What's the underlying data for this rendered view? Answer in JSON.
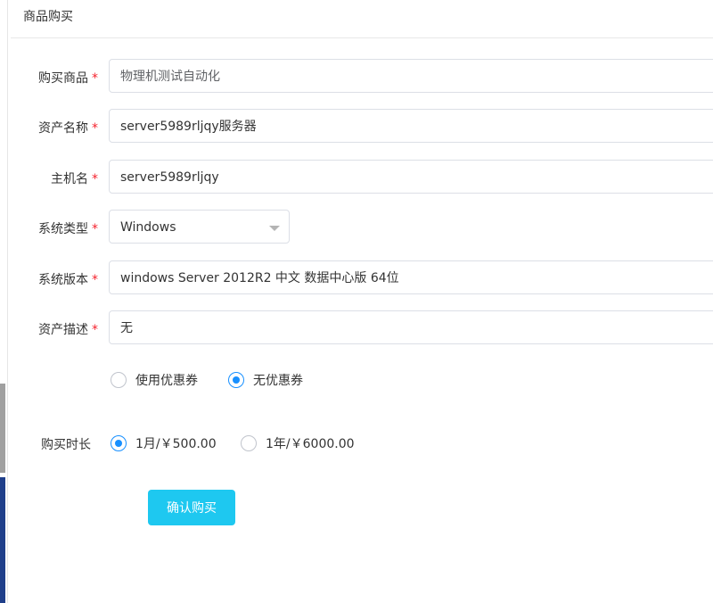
{
  "dialog": {
    "title": "商品购买"
  },
  "form": {
    "required_mark": "*",
    "product": {
      "label": "购买商品",
      "value": "物理机测试自动化"
    },
    "asset_name": {
      "label": "资产名称",
      "value": "server5989rljqy服务器"
    },
    "hostname": {
      "label": "主机名",
      "value": "server5989rljqy"
    },
    "os_type": {
      "label": "系统类型",
      "value": "Windows"
    },
    "os_version": {
      "label": "系统版本",
      "value": "windows Server 2012R2 中文 数据中心版 64位"
    },
    "asset_desc": {
      "label": "资产描述",
      "value": "无"
    },
    "coupon": {
      "options": [
        {
          "label": "使用优惠券",
          "checked": false
        },
        {
          "label": "无优惠券",
          "checked": true
        }
      ]
    },
    "duration": {
      "label": "购买时长",
      "options": [
        {
          "label": "1月/￥500.00",
          "checked": true
        },
        {
          "label": "1年/￥6000.00",
          "checked": false
        }
      ]
    },
    "submit_label": "确认购买"
  },
  "colors": {
    "accent": "#1890ff",
    "button": "#1ec8f0",
    "required": "#f5222d"
  }
}
